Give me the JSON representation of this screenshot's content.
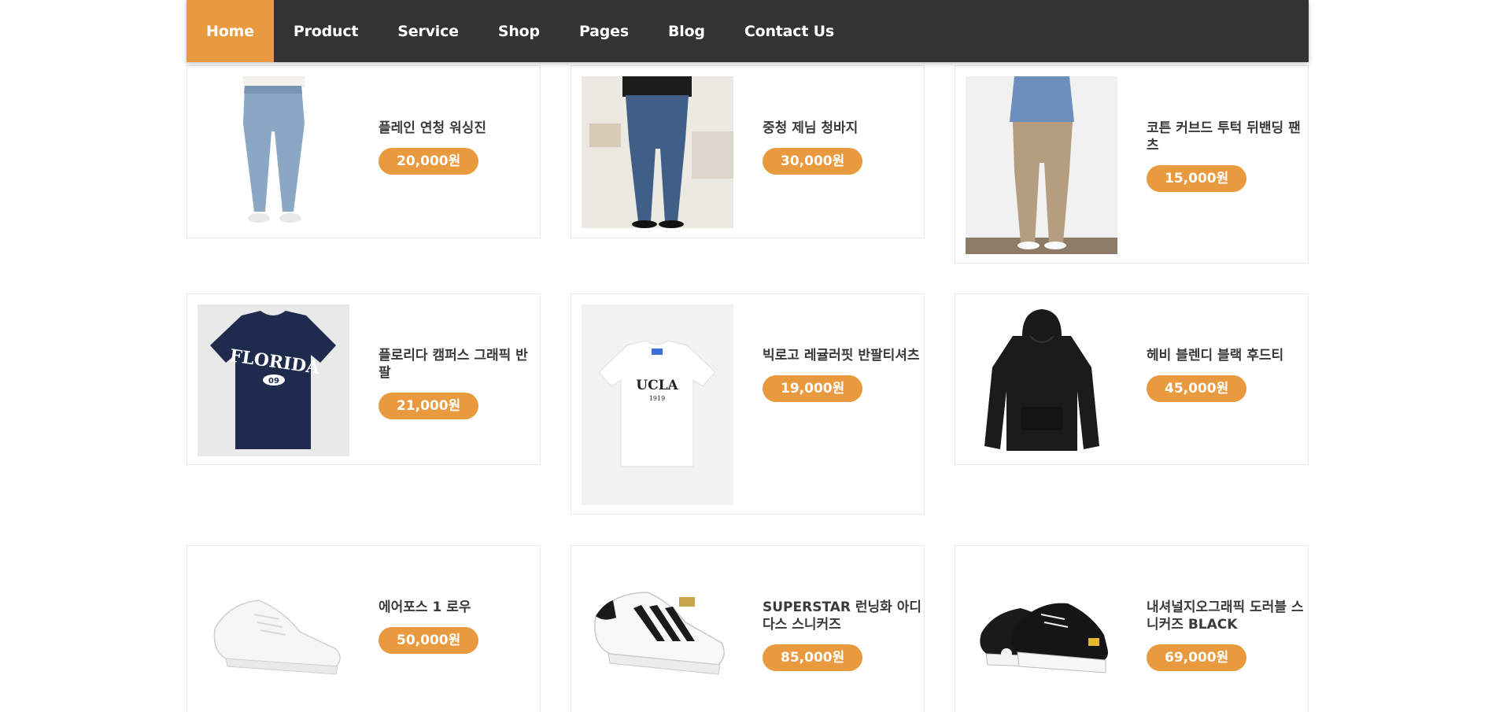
{
  "nav": {
    "items": [
      {
        "label": "Home",
        "active": true
      },
      {
        "label": "Product"
      },
      {
        "label": "Service"
      },
      {
        "label": "Shop"
      },
      {
        "label": "Pages"
      },
      {
        "label": "Blog"
      },
      {
        "label": "Contact Us"
      }
    ],
    "accent_color": "#e99a3f",
    "bar_color": "#333333"
  },
  "products": [
    {
      "name": "플레인 연청 워싱진",
      "price": "20,000원",
      "image": "light-blue-jeans"
    },
    {
      "name": "중청 제님 청바지",
      "price": "30,000원",
      "image": "medium-blue-jeans"
    },
    {
      "name": "코튼 커브드 투턱 뒤밴딩 팬츠",
      "price": "15,000원",
      "image": "beige-pants"
    },
    {
      "name": "플로리다 캠퍼스 그래픽 반팔",
      "price": "21,000원",
      "image": "navy-tshirt",
      "shirt_text": "FLORIDA",
      "shirt_sub": "09"
    },
    {
      "name": "빅로고 레귤러핏 반팔티셔츠",
      "price": "19,000원",
      "image": "white-tshirt",
      "shirt_text": "UCLA",
      "shirt_sub": "1919"
    },
    {
      "name": "헤비 블렌디 블랙 후드티",
      "price": "45,000원",
      "image": "black-hoodie"
    },
    {
      "name": "에어포스 1 로우",
      "price": "50,000원",
      "image": "white-sneaker"
    },
    {
      "name": "SUPERSTAR 런닝화 아디다스 스니커즈",
      "price": "85,000원",
      "image": "striped-sneaker"
    },
    {
      "name": "내셔널지오그래픽 도러블 스니커즈 BLACK",
      "price": "69,000원",
      "image": "black-canvas-sneaker"
    }
  ]
}
